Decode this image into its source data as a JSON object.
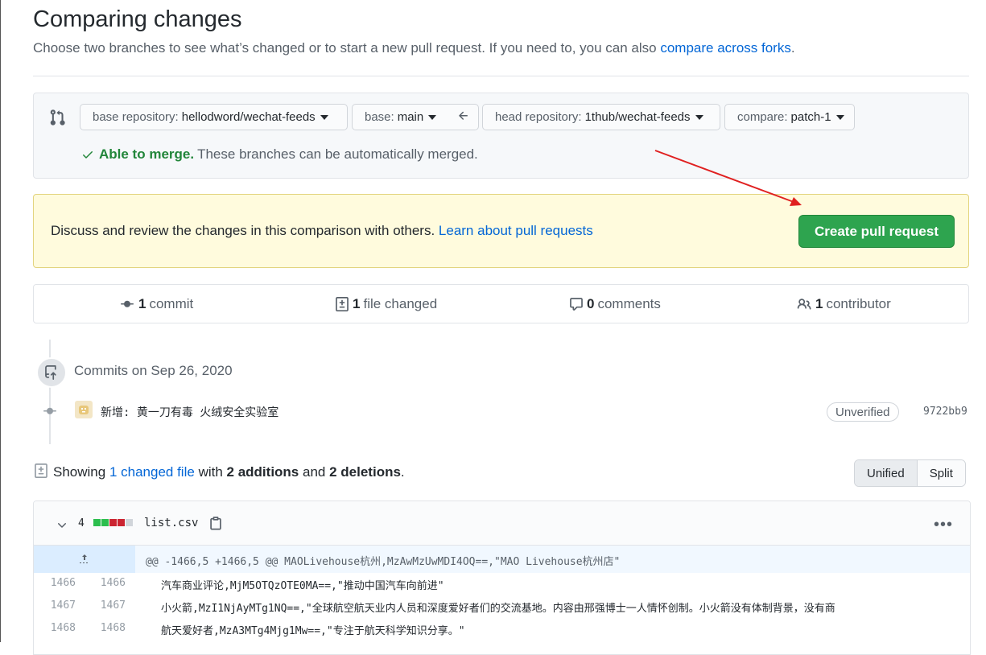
{
  "header": {
    "title": "Comparing changes",
    "subtitle": "Choose two branches to see what’s changed or to start a new pull request. If you need to, you can also",
    "forks_link": "compare across forks",
    "forks_period": "."
  },
  "range": {
    "base_repo_label": "base repository:",
    "base_repo_value": "hellodword/wechat-feeds",
    "base_label": "base:",
    "base_value": "main",
    "head_repo_label": "head repository:",
    "head_repo_value": "1thub/wechat-feeds",
    "compare_label": "compare:",
    "compare_value": "patch-1",
    "merge_status": "Able to merge.",
    "merge_detail": "These branches can be automatically merged."
  },
  "flash": {
    "message": "Discuss and review the changes in this comparison with others.",
    "learn_link": "Learn about pull requests",
    "create_button": "Create pull request"
  },
  "stats": {
    "commits_count": "1",
    "commits_label": "commit",
    "files_count": "1",
    "files_label": "file changed",
    "comments_count": "0",
    "comments_label": "comments",
    "contributors_count": "1",
    "contributors_label": "contributor"
  },
  "timeline": {
    "title": "Commits on Sep 26, 2020",
    "commit_message": "新增: 黄一刀有毒 火绒安全实验室",
    "verification": "Unverified",
    "sha": "9722bb9"
  },
  "summary": {
    "prefix": "Showing",
    "changed_link": "1 changed file",
    "with": "with",
    "additions": "2 additions",
    "and": "and",
    "deletions": "2 deletions",
    "period": ".",
    "unified": "Unified",
    "split": "Split"
  },
  "file": {
    "changes": "4",
    "name": "list.csv",
    "diffstat_colors": [
      "#2cbe4e",
      "#2cbe4e",
      "#cb2431",
      "#cb2431",
      "#d1d5da"
    ],
    "hunk_header": "@@ -1466,5 +1466,5 @@ MAOLivehouse杭州,MzAwMzUwMDI4OQ==,\"MAO Livehouse杭州店\"",
    "lines": [
      {
        "old": "1466",
        "new": "1466",
        "text": "汽车商业评论,MjM5OTQzOTE0MA==,\"推动中国汽车向前进\""
      },
      {
        "old": "1467",
        "new": "1467",
        "text": "小火箭,MzI1NjAyMTg1NQ==,\"全球航空航天业内人员和深度爱好者们的交流基地。内容由邢强博士一人情怀创制。小火箭没有体制背景，没有商"
      },
      {
        "old": "1468",
        "new": "1468",
        "text": "航天爱好者,MzA3MTg4Mjg1Mw==,\"专注于航天科学知识分享。\""
      }
    ]
  },
  "colors": {
    "link": "#0366d6",
    "success": "#22863a",
    "primary_button": "#2ea44f",
    "flash_bg": "#fffbdd",
    "annotation_arrow": "#e02020"
  }
}
